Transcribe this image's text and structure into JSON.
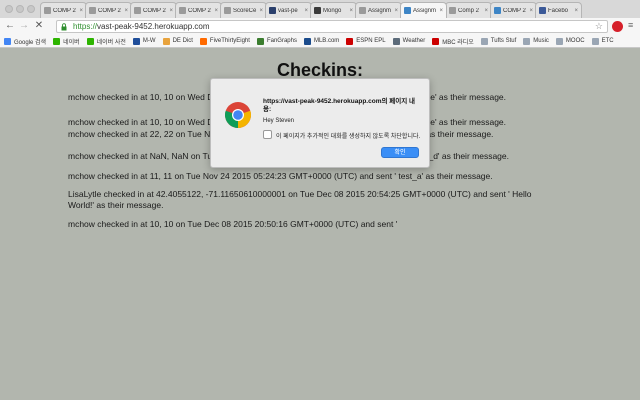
{
  "tabs": [
    {
      "title": "COMP 2",
      "color": "#9a9a9a"
    },
    {
      "title": "COMP 2",
      "color": "#9a9a9a"
    },
    {
      "title": "COMP 2",
      "color": "#9a9a9a"
    },
    {
      "title": "COMP 2",
      "color": "#9a9a9a"
    },
    {
      "title": "ScoreCe",
      "color": "#9a9a9a"
    },
    {
      "title": "vast-pe",
      "color": "#2a3f6c"
    },
    {
      "title": "Mongo",
      "color": "#3b3b3b"
    },
    {
      "title": "Assignm",
      "color": "#9a9a9a"
    },
    {
      "title": "Assignm",
      "color": "#3d85c6"
    },
    {
      "title": "Comp 2",
      "color": "#9a9a9a"
    },
    {
      "title": "COMP 2",
      "color": "#3d85c6"
    },
    {
      "title": "Facebo",
      "color": "#3b5998"
    }
  ],
  "toolbar": {
    "url_scheme": "https://",
    "url_host": "vast-peak-9452.herokuapp.com"
  },
  "bookmarks": [
    {
      "label": "Google 검색",
      "color": "#4285f4"
    },
    {
      "label": "네이버",
      "color": "#2db400"
    },
    {
      "label": "네이버 사전",
      "color": "#2db400"
    },
    {
      "label": "M-W",
      "color": "#1f4e9a"
    },
    {
      "label": "DE Dict",
      "color": "#e8a33d"
    },
    {
      "label": "FiveThirtyEight",
      "color": "#ff6a00"
    },
    {
      "label": "FanGraphs",
      "color": "#3b7d2f"
    },
    {
      "label": "MLB.com",
      "color": "#1a4b8c"
    },
    {
      "label": "ESPN EPL",
      "color": "#cc0000"
    },
    {
      "label": "Weather",
      "color": "#5c6b7a"
    },
    {
      "label": "MBC 라디오",
      "color": "#cc0000"
    },
    {
      "label": "Tufts Stuf",
      "color": "#9aa6b4"
    },
    {
      "label": "Music",
      "color": "#9aa6b4"
    },
    {
      "label": "MOOC",
      "color": "#9aa6b4"
    },
    {
      "label": "ETC",
      "color": "#9aa6b4"
    }
  ],
  "page": {
    "title": "Checkins:",
    "checkins": [
      {
        "lines": [
          "mchow checked in at 10, 10 on Wed Dec 08 2015 20:50:16 GMT+0000 (UTC) and sent ' hey jude' as their message."
        ]
      },
      {
        "lines": [
          "mchow checked in at 10, 10 on Wed Dec 08 2015 20:50:16 GMT+0000 (UTC) and sent ' hey jude' as their message."
        ]
      },
      {
        "lines": [
          "mchow checked in at 22, 22 on Tue Nov 24 2015 05:24:23 GMT+0000 (UTC) and sent ' test_c' as their message."
        ]
      },
      {
        "lines": [
          "mchow checked in at NaN, NaN on Tue Nov 24 2015 05:24:23 GMT+0000 (UTC) and sent ' test_d' as their message."
        ]
      },
      {
        "lines": [
          "mchow checked in at 11, 11 on Tue Nov 24 2015 05:24:23 GMT+0000 (UTC) and sent ' test_a' as their message."
        ]
      },
      {
        "lines": [
          "LisaLytle checked in at 42.4055122, -71.11650610000001 on Tue Dec 08 2015 20:54:25 GMT+0000 (UTC) and sent ' Hello",
          "World!' as their message."
        ]
      },
      {
        "lines": [
          "mchow checked in at 10, 10 on Tue Dec 08 2015 20:50:16 GMT+0000 (UTC) and sent '"
        ]
      }
    ]
  },
  "dialog": {
    "title": "https://vast-peak-9452.herokuapp.com의 페이지 내용:",
    "message": "Hey Steven",
    "checkbox_label": "이 페이지가 추가적인 대화를 생성하지 않도록 차단합니다.",
    "ok_label": "확인"
  }
}
